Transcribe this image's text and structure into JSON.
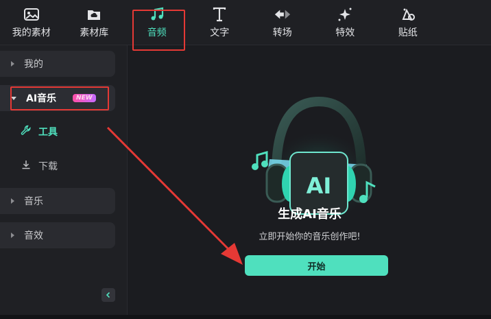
{
  "tabs": [
    {
      "label": "我的素材",
      "icon": "image-icon"
    },
    {
      "label": "素材库",
      "icon": "cloud-folder-icon"
    },
    {
      "label": "音频",
      "icon": "music-note-icon"
    },
    {
      "label": "文字",
      "icon": "text-icon"
    },
    {
      "label": "转场",
      "icon": "transition-icon"
    },
    {
      "label": "特效",
      "icon": "sparkle-icon"
    },
    {
      "label": "贴纸",
      "icon": "sticker-icon"
    }
  ],
  "active_tab": "音频",
  "sidebar": {
    "my": "我的",
    "ai_music": "AI音乐",
    "new_badge": "NEW",
    "tools": "工具",
    "download": "下载",
    "music": "音乐",
    "sfx": "音效"
  },
  "main": {
    "hero_text": "AI",
    "title": "生成AI音乐",
    "subtitle": "立即开始你的音乐创作吧!",
    "start_button": "开始"
  },
  "colors": {
    "accent": "#4fe0be",
    "annotation_red": "#e53935",
    "background": "#1b1c20"
  }
}
